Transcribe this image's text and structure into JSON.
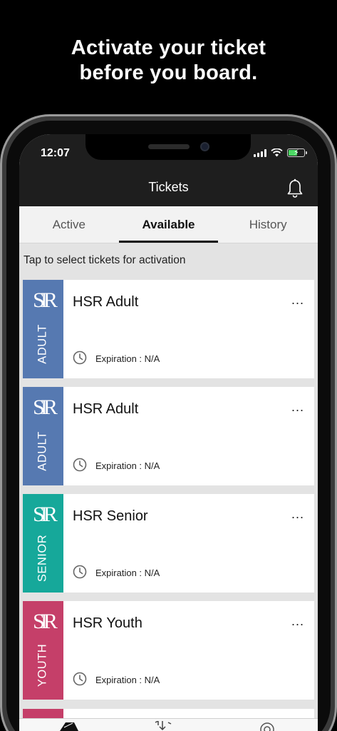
{
  "promo": {
    "line1": "Activate your ticket",
    "line2": "before you board."
  },
  "status_bar": {
    "time": "12:07"
  },
  "header": {
    "title": "Tickets",
    "bell_icon": "bell-icon"
  },
  "tabs": [
    {
      "label": "Active",
      "selected": false
    },
    {
      "label": "Available",
      "selected": true
    },
    {
      "label": "History",
      "selected": false
    }
  ],
  "hint": "Tap to select tickets for activation",
  "tickets": [
    {
      "name": "HSR Adult",
      "type": "ADULT",
      "color": "#5679b1",
      "more": "...",
      "expiration": "Expiration : N/A",
      "logo": "SIR"
    },
    {
      "name": "HSR Adult",
      "type": "ADULT",
      "color": "#5679b1",
      "more": "...",
      "expiration": "Expiration : N/A",
      "logo": "SIR"
    },
    {
      "name": "HSR Senior",
      "type": "SENIOR",
      "color": "#16a89a",
      "more": "...",
      "expiration": "Expiration : N/A",
      "logo": "SIR"
    },
    {
      "name": "HSR Youth",
      "type": "YOUTH",
      "color": "#c53f69",
      "more": "...",
      "expiration": "Expiration : N/A",
      "logo": "SIR"
    }
  ],
  "colors": {
    "header_bg": "#1e1e1e",
    "tabs_bg": "#f2f2f2",
    "list_bg": "#e3e3e3",
    "partial_card": "#c53f69"
  }
}
